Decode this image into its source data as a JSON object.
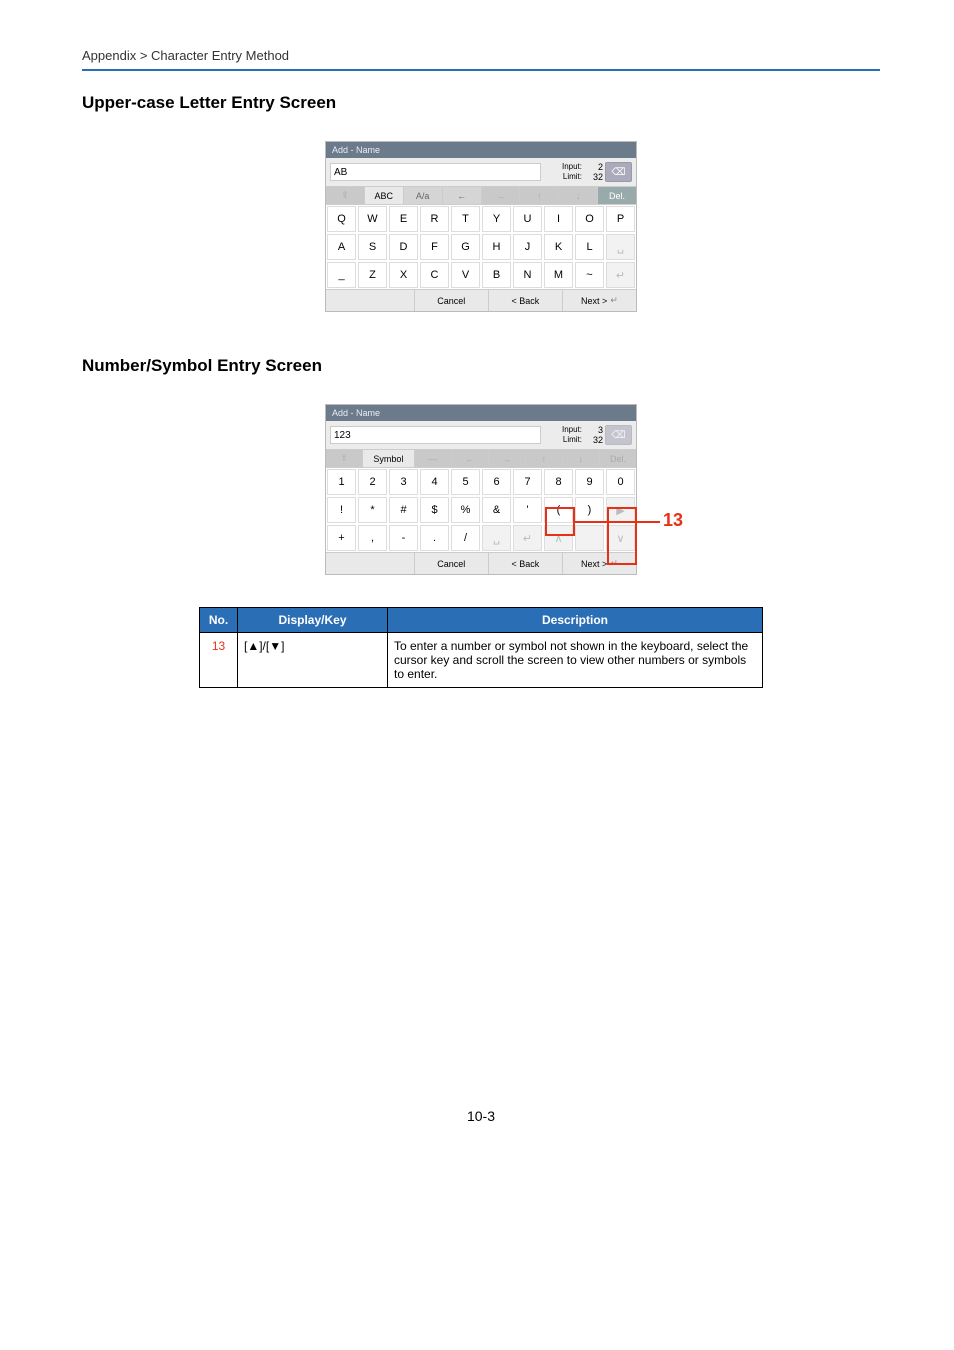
{
  "breadcrumb": "Appendix > Character Entry Method",
  "section1": "Upper-case Letter Entry Screen",
  "section2": "Number/Symbol Entry Screen",
  "page_num": "10-3",
  "kbd_upper": {
    "title": "Add - Name",
    "field": "AB",
    "info1": "Input:",
    "info2": "Limit:",
    "n1": "2",
    "n2": "32",
    "bksp": "⌫",
    "tabs": {
      "shift": "⇧",
      "abc": "ABC",
      "aa": "A/a",
      "larr": "←",
      "rarr": "→",
      "up": "↑",
      "down": "↓",
      "del": "Del."
    },
    "rows": [
      [
        "Q",
        "W",
        "E",
        "R",
        "T",
        "Y",
        "U",
        "I",
        "O",
        "P"
      ],
      [
        "A",
        "S",
        "D",
        "F",
        "G",
        "H",
        "J",
        "K",
        "L",
        "␣"
      ],
      [
        "_",
        "Z",
        "X",
        "C",
        "V",
        "B",
        "N",
        "M",
        "~",
        "↵"
      ]
    ],
    "bottom": {
      "cancel": "Cancel",
      "back": "< Back",
      "next": "Next >",
      "enter": "↵"
    }
  },
  "kbd_sym": {
    "title": "Add - Name",
    "field": "123",
    "info1": "Input:",
    "info2": "Limit:",
    "n1": "3",
    "n2": "32",
    "bksp": "⌫",
    "tabs": {
      "shift": "⇧",
      "sym": "Symbol",
      "dash": "—",
      "larr": "←",
      "rarr": "→",
      "up": "↑",
      "down": "↓",
      "del": "Del."
    },
    "rows": [
      [
        "1",
        "2",
        "3",
        "4",
        "5",
        "6",
        "7",
        "8",
        "9",
        "0"
      ],
      [
        "!",
        "*",
        "#",
        "$",
        "%",
        "&",
        "'",
        "(",
        ")",
        "▶"
      ],
      [
        "+",
        ",",
        "-",
        ".",
        "/",
        "␣",
        "↵",
        "∧",
        "",
        "∨"
      ]
    ],
    "bottom": {
      "cancel": "Cancel",
      "back": "< Back",
      "next": "Next >",
      "enter": "↵"
    },
    "callout": "13"
  },
  "table": {
    "h_no": "No.",
    "h_key": "Display/Key",
    "h_desc": "Description",
    "r_no": "13",
    "r_key": "[▲]/[▼]",
    "r_desc": "To enter a number or symbol not shown in the keyboard, select the cursor key and scroll the screen to view other numbers or symbols to enter."
  }
}
